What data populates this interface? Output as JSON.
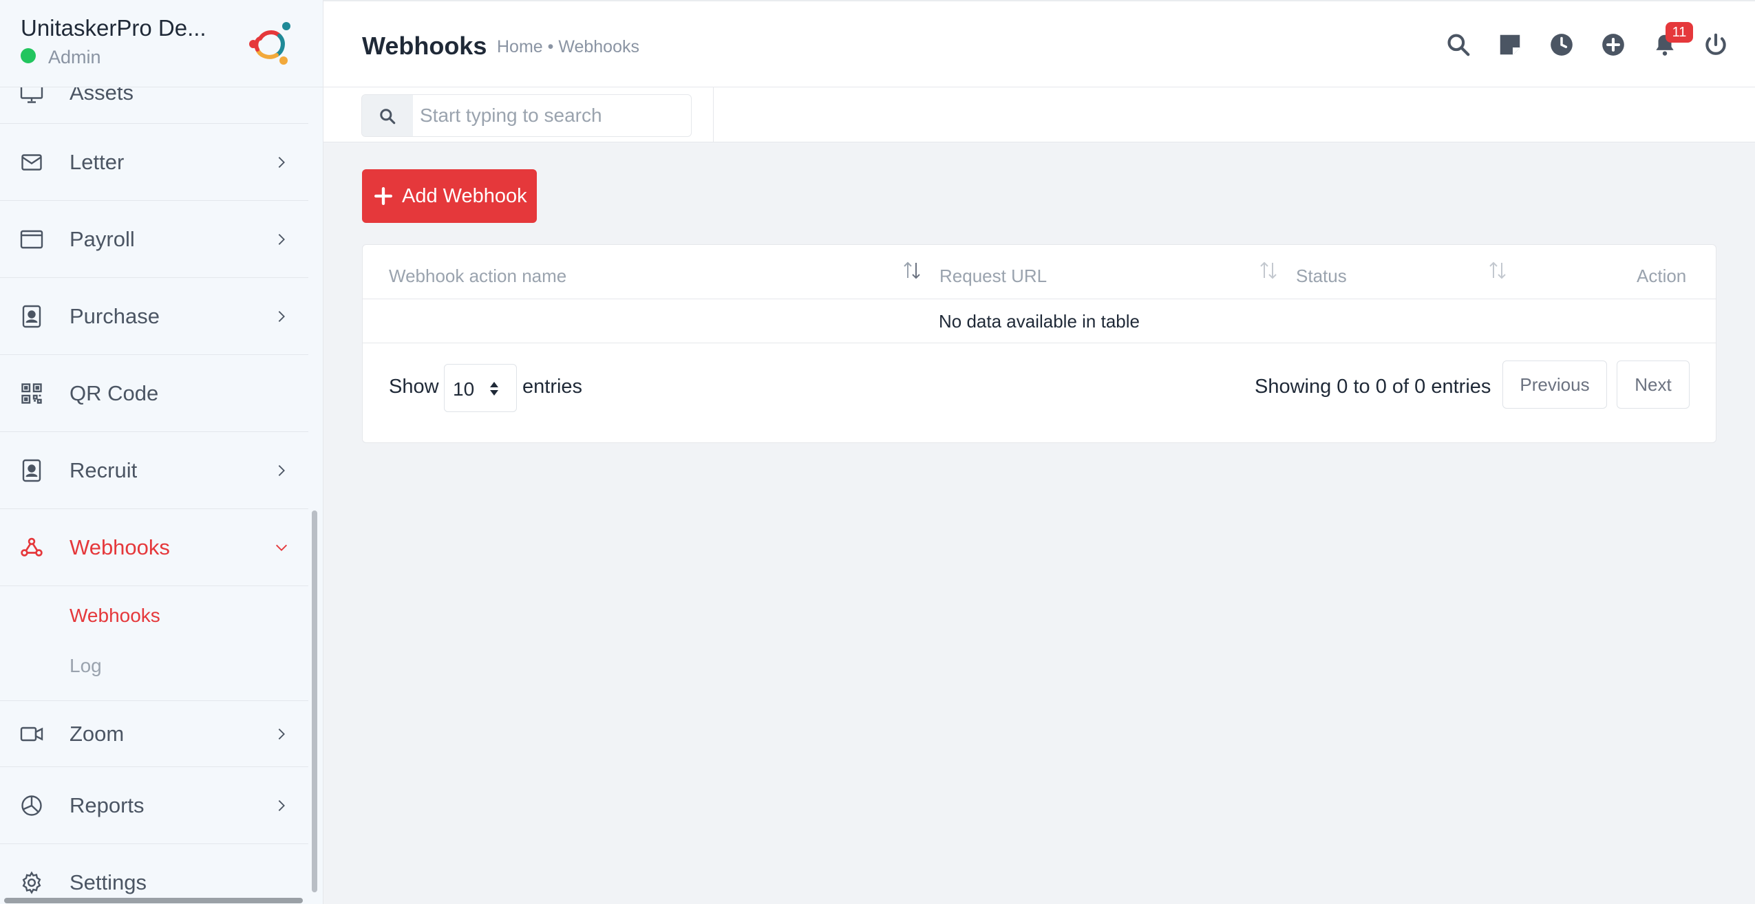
{
  "brand": {
    "name": "UnitaskerPro De...",
    "role": "Admin"
  },
  "sidebar": {
    "items": [
      {
        "label": "Assets",
        "icon": "monitor-icon"
      },
      {
        "label": "Letter",
        "icon": "envelope-icon"
      },
      {
        "label": "Payroll",
        "icon": "wallet-icon"
      },
      {
        "label": "Purchase",
        "icon": "id-badge-icon"
      },
      {
        "label": "QR Code",
        "icon": "qr-code-icon"
      },
      {
        "label": "Recruit",
        "icon": "id-badge-icon"
      },
      {
        "label": "Webhooks",
        "icon": "webhook-icon"
      },
      {
        "label": "Zoom",
        "icon": "video-icon"
      },
      {
        "label": "Reports",
        "icon": "pie-chart-icon"
      },
      {
        "label": "Settings",
        "icon": "gear-icon"
      }
    ],
    "webhooks_sub": [
      {
        "label": "Webhooks"
      },
      {
        "label": "Log"
      }
    ]
  },
  "header": {
    "title": "Webhooks",
    "breadcrumb": "Home • Webhooks",
    "notification_count": "11"
  },
  "search": {
    "placeholder": "Start typing to search",
    "value": ""
  },
  "main": {
    "add_button": "Add Webhook",
    "table": {
      "columns": [
        "Webhook action name",
        "Request URL",
        "Status",
        "Action"
      ],
      "empty_text": "No data available in table"
    },
    "length": {
      "show": "Show",
      "value": "10",
      "entries": "entries"
    },
    "info": "Showing 0 to 0 of 0 entries",
    "pagination": {
      "previous": "Previous",
      "next": "Next"
    }
  },
  "colors": {
    "accent": "#e5383b",
    "online": "#22c55e"
  }
}
